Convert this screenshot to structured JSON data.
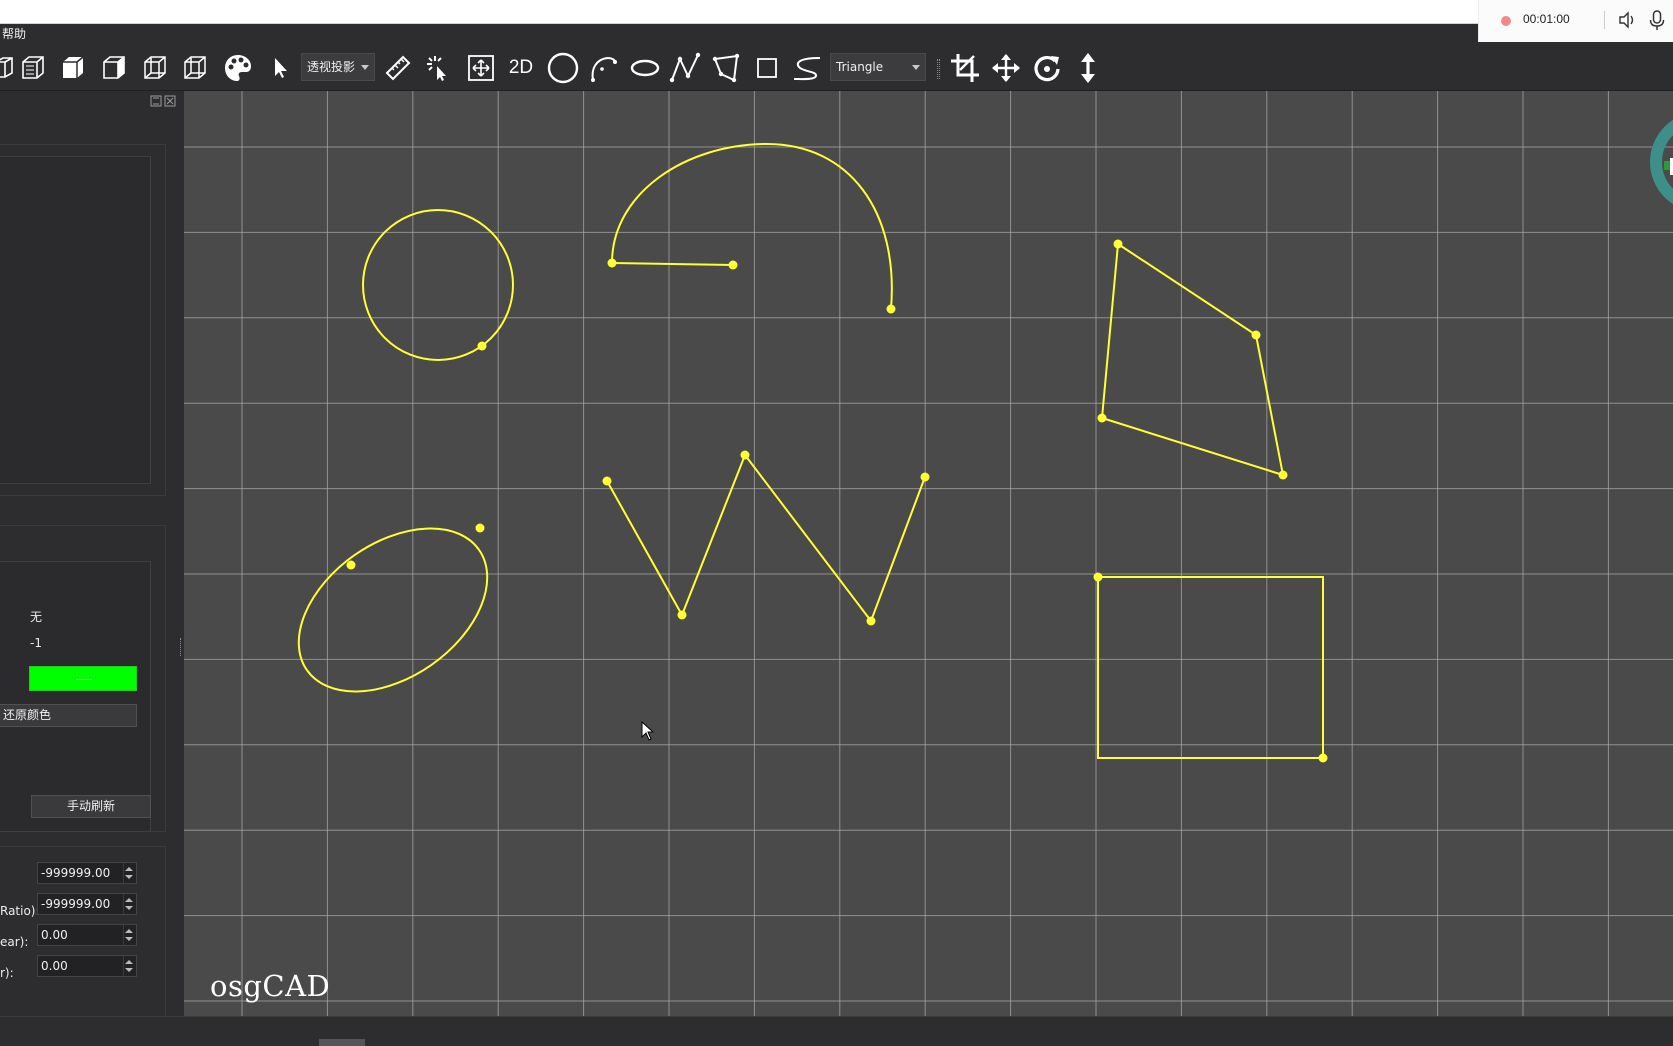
{
  "menubar": {
    "help_label": "帮助"
  },
  "recorder": {
    "time": "00:01:00",
    "record_dot_color": "#f08a8a"
  },
  "toolbar": {
    "projection_combo": "透视投影",
    "mode_2d": "2D",
    "shape_combo": "Triangle"
  },
  "left_panel": {
    "value_none": "无",
    "value_index": "-1",
    "color_swatch": "#00ff00",
    "restore_color_button": "还原颜色",
    "manual_refresh_button": "手动刷新",
    "fields": [
      {
        "label": "",
        "value": "-999999.00"
      },
      {
        "label": "Ratio):",
        "value": "-999999.00"
      },
      {
        "label": "ear):",
        "value": "0.00"
      },
      {
        "label": "r):",
        "value": "0.00"
      }
    ]
  },
  "viewport": {
    "background": "#4a4a4a",
    "grid_color": "#a8a8a8",
    "shape_color": "#ffff33",
    "watermark": "osgCAD"
  }
}
